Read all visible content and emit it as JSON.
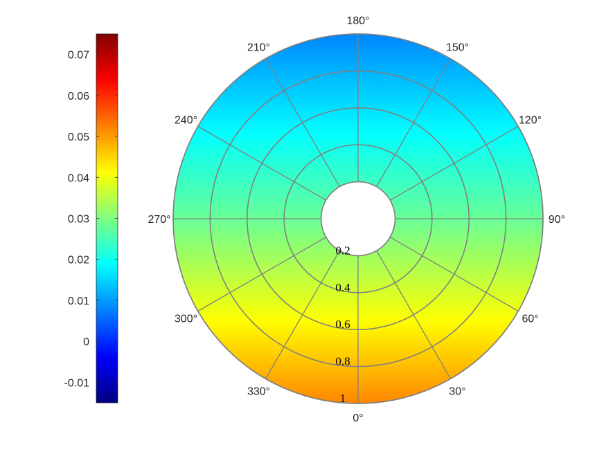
{
  "chart_data": {
    "type": "heatmap",
    "subtype": "polar-annulus",
    "colormap": "jet",
    "colorbar": {
      "position": "left",
      "ticks": [
        -0.01,
        0,
        0.01,
        0.02,
        0.03,
        0.04,
        0.05,
        0.06,
        0.07
      ],
      "tick_labels": [
        "-0.01",
        "0",
        "0.01",
        "0.02",
        "0.03",
        "0.04",
        "0.05",
        "0.06",
        "0.07"
      ],
      "range": [
        -0.015,
        0.075
      ]
    },
    "angle_ticks": [
      0,
      30,
      60,
      90,
      120,
      150,
      180,
      210,
      240,
      270,
      300,
      330
    ],
    "angle_tick_labels": [
      "0°",
      "30°",
      "60°",
      "90°",
      "120°",
      "150°",
      "180°",
      "210°",
      "240°",
      "270°",
      "300°",
      "330°"
    ],
    "angle_zero": "bottom",
    "angle_direction": "counterclockwise",
    "radius_ticks": [
      0.2,
      0.4,
      0.6,
      0.8,
      1
    ],
    "radius_tick_labels": [
      "0.2",
      "0.4",
      "0.6",
      "0.8",
      "1"
    ],
    "r_range": [
      0,
      1
    ],
    "hole_radius": 0.2,
    "grid": true,
    "field": "value varies with vertical position: ~0.052 at 0° (bottom), ~0.028 at 90°/270°, ~0.008 at 180° (top)",
    "value_at_bottom": 0.052,
    "value_at_middle": 0.028,
    "value_at_top": 0.008
  },
  "colors": {
    "grid": "#808080",
    "background": "#ffffff",
    "text": "#262626"
  }
}
